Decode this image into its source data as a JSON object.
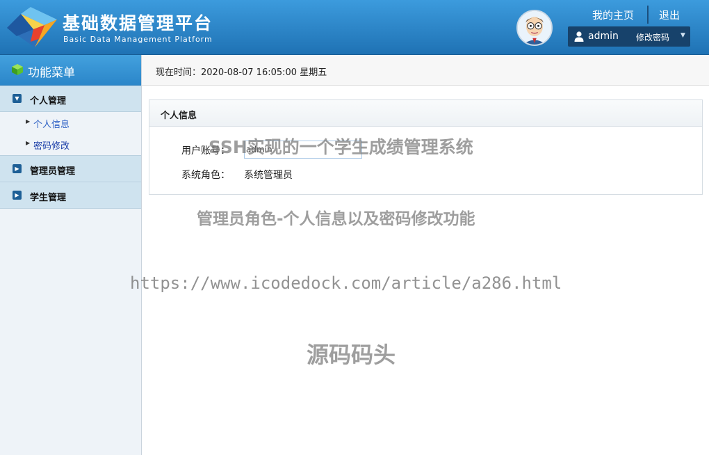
{
  "header": {
    "title": "基础数据管理平台",
    "subtitle": "Basic Data Management Platform",
    "home_link": "我的主页",
    "logout_link": "退出",
    "username": "admin",
    "change_password": "修改密码",
    "icons": {
      "logo": "cube-logo-icon",
      "avatar": "avatar-icon",
      "user": "user-icon",
      "dropdown": "caret-down-icon"
    }
  },
  "sidebar": {
    "heading": "功能菜单",
    "groups": [
      {
        "label": "个人管理",
        "expanded": true,
        "items": [
          {
            "label": "个人信息"
          },
          {
            "label": "密码修改"
          }
        ]
      },
      {
        "label": "管理员管理",
        "expanded": false
      },
      {
        "label": "学生管理",
        "expanded": false
      }
    ]
  },
  "main": {
    "time_text": "现在时间：2020-08-07 16:05:00 星期五",
    "panel": {
      "title": "个人信息",
      "account_label": "用户账号：",
      "account_value": "admin",
      "role_label": "系统角色：",
      "role_value": "系统管理员"
    }
  },
  "watermarks": {
    "line1": "SSH实现的一个学生成绩管理系统",
    "line2": "管理员角色-个人信息以及密码修改功能",
    "line3": "https://www.icodedock.com/article/a286.html",
    "line4": "源码码头"
  },
  "colors": {
    "header_top": "#3c9bdd",
    "header_bottom": "#1f72b4",
    "user_box": "#17426b",
    "sidebar_group": "#cfe3ef"
  }
}
